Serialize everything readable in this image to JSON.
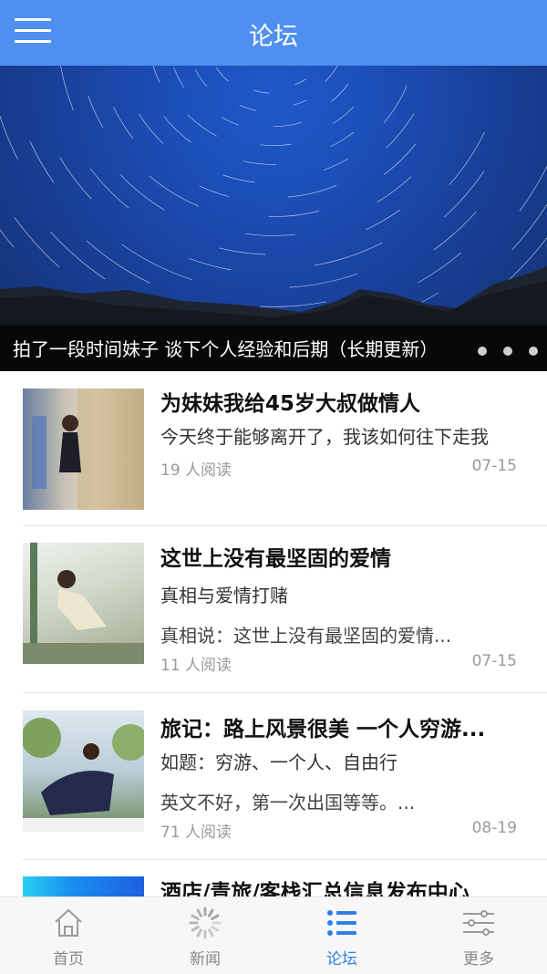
{
  "header": {
    "title": "论坛"
  },
  "banner": {
    "caption": "拍了一段时间妹子 谈下个人经验和后期（长期更新）",
    "dots_count": 3
  },
  "posts": [
    {
      "title": "为妹妹我给45岁大叔做情人",
      "desc1": "今天终于能够离开了，我该如何往下走我",
      "desc2": "",
      "reads": "19  人阅读",
      "date": "07-15"
    },
    {
      "title": "这世上没有最坚固的爱情",
      "desc1": "真相与爱情打赌",
      "desc2": "真相说：这世上没有最坚固的爱情...",
      "reads": "11  人阅读",
      "date": "07-15"
    },
    {
      "title": "旅记：路上风景很美 一个人穷游...",
      "desc1": "如题：穷游、一个人、自由行",
      "desc2": "英文不好，第一次出国等等。...",
      "reads": "71  人阅读",
      "date": "08-19"
    },
    {
      "title": "酒店/青旅/客栈汇总信息发布中心",
      "desc1": "",
      "desc2": "",
      "reads": "",
      "date": ""
    }
  ],
  "tabs": [
    {
      "label": "首页",
      "icon": "home-icon",
      "active": false
    },
    {
      "label": "新闻",
      "icon": "loading-spinner-icon",
      "active": false
    },
    {
      "label": "论坛",
      "icon": "list-icon",
      "active": true
    },
    {
      "label": "更多",
      "icon": "settings-sliders-icon",
      "active": false
    }
  ],
  "colors": {
    "accent": "#4f8ff0",
    "active_tab": "#2f7fe9",
    "muted": "#9a9a9a"
  }
}
